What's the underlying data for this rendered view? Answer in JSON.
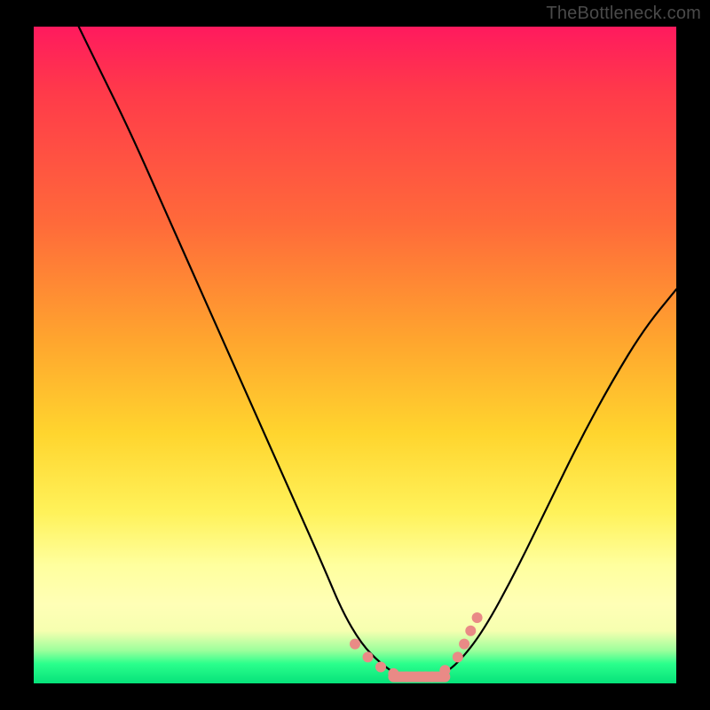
{
  "watermark": "TheBottleneck.com",
  "chart_data": {
    "type": "line",
    "title": "",
    "xlabel": "",
    "ylabel": "",
    "xlim": [
      0,
      100
    ],
    "ylim": [
      0,
      100
    ],
    "grid": false,
    "series": [
      {
        "name": "bottleneck-curve",
        "x": [
          7,
          10,
          15,
          20,
          25,
          30,
          35,
          40,
          45,
          48,
          51,
          54,
          57,
          60,
          63,
          66,
          70,
          75,
          80,
          85,
          90,
          95,
          100
        ],
        "y": [
          100,
          94,
          84,
          73,
          62,
          51,
          40,
          29,
          18,
          11,
          6,
          3,
          1,
          1,
          1,
          3,
          8,
          17,
          27,
          37,
          46,
          54,
          60
        ]
      }
    ],
    "markers": {
      "name": "highlight-dots",
      "x": [
        50,
        52,
        54,
        56,
        58,
        60,
        61,
        62,
        64,
        66,
        67,
        68,
        69
      ],
      "y": [
        6,
        4,
        2.5,
        1.5,
        1,
        1,
        1,
        1,
        2,
        4,
        6,
        8,
        10
      ]
    },
    "gradient_stops": [
      {
        "pos": 0.0,
        "color": "#ff1a5e"
      },
      {
        "pos": 0.1,
        "color": "#ff3a4a"
      },
      {
        "pos": 0.3,
        "color": "#ff6a3a"
      },
      {
        "pos": 0.48,
        "color": "#ffa62e"
      },
      {
        "pos": 0.62,
        "color": "#ffd52e"
      },
      {
        "pos": 0.74,
        "color": "#fff25a"
      },
      {
        "pos": 0.82,
        "color": "#ffff9e"
      },
      {
        "pos": 0.88,
        "color": "#ffffb6"
      },
      {
        "pos": 0.92,
        "color": "#f6ffb0"
      },
      {
        "pos": 0.95,
        "color": "#9cff9c"
      },
      {
        "pos": 0.97,
        "color": "#2bff8c"
      },
      {
        "pos": 1.0,
        "color": "#06e27a"
      }
    ]
  }
}
